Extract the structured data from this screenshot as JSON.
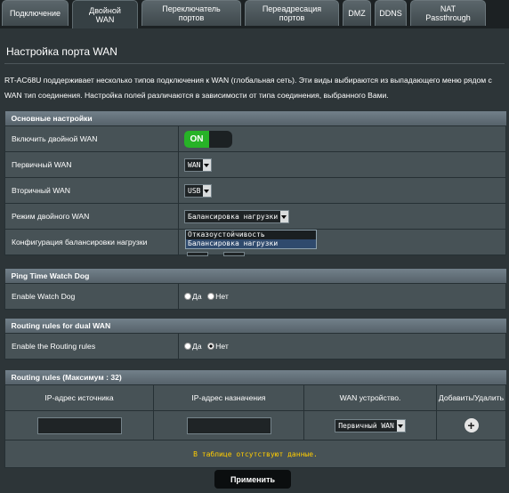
{
  "tabs": [
    {
      "label": "Подключение"
    },
    {
      "label": "Двойной WAN"
    },
    {
      "label": "Переключатель портов"
    },
    {
      "label": "Переадресация портов"
    },
    {
      "label": "DMZ"
    },
    {
      "label": "DDNS"
    },
    {
      "label": "NAT Passthrough"
    }
  ],
  "page": {
    "title": "Настройка порта WAN",
    "description": "RT-AC68U поддерживает несколько типов подключения к WAN (глобальная сеть). Эти виды выбираются из выпадающего меню рядом с WAN тип соединения. Настройка полей различаются в зависимости от типа соединения, выбранного Вами."
  },
  "basic": {
    "header": "Основные настройки",
    "enable_label": "Включить двойной WAN",
    "enable_value": "ON",
    "primary_label": "Первичный WAN",
    "primary_value": "WAN",
    "secondary_label": "Вторичный WAN",
    "secondary_value": "USB",
    "mode_label": "Режим двойного WAN",
    "mode_value": "Балансировка нагрузки",
    "lb_label": "Конфигурация балансировки нагрузки",
    "mode_options": [
      "Отказоустойчивость",
      "Балансировка нагрузки"
    ]
  },
  "ping": {
    "header": "Ping Time Watch Dog",
    "label": "Enable Watch Dog",
    "yes": "Да",
    "no": "Нет",
    "selected": "no"
  },
  "routing": {
    "header": "Routing rules for dual WAN",
    "label": "Enable the Routing rules",
    "yes": "Да",
    "no": "Нет",
    "selected": "no"
  },
  "rules": {
    "header": "Routing rules (Максимум : 32)",
    "columns": [
      "IP-адрес источника",
      "IP-адрес назначения",
      "WAN устройство.",
      "Добавить/Удалить"
    ],
    "wan_select": "Первичный WAN",
    "empty": "В таблице отсутствуют данные."
  },
  "apply_label": "Применить"
}
